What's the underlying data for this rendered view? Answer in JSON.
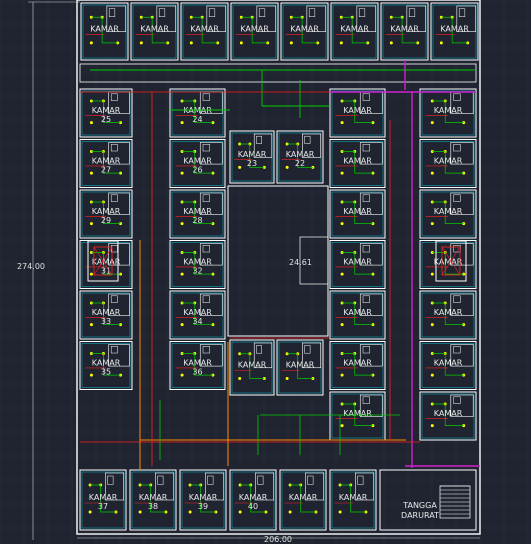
{
  "drawing": {
    "dimensions": {
      "overall_height": "274.00",
      "overall_width": "206.00",
      "courtyard_width": "24.61"
    },
    "room_label": "KAMAR",
    "stair_label_line1": "TANGGA",
    "stair_label_line2": "DARURAT",
    "top_row_numbers": [
      "",
      "",
      "",
      "",
      "",
      "",
      "",
      ""
    ],
    "left_outer_numbers": [
      "25",
      "27",
      "29",
      "31",
      "33",
      "35"
    ],
    "left_inner_numbers": [
      "24",
      "26",
      "28",
      "32",
      "34",
      "36"
    ],
    "court_top_numbers": [
      "23",
      "22"
    ],
    "court_bottom_numbers": [
      "",
      ""
    ],
    "right_inner_numbers": [
      "",
      "",
      "",
      "",
      "",
      "",
      ""
    ],
    "right_outer_numbers": [
      "",
      "",
      "",
      "",
      "",
      "",
      "",
      ""
    ],
    "bottom_row_numbers": [
      "37",
      "38",
      "39",
      "40",
      "",
      ""
    ],
    "colors": {
      "background": "#1f2430",
      "wall": "#ffffff",
      "fixture": "#ffff00",
      "lighting_circuit": "#00cc00",
      "power_circuit": "#ff2020",
      "main_feeder": "#d020d0",
      "secondary_feeder": "#ff8c00",
      "room_outline": "#00e5ff"
    }
  }
}
